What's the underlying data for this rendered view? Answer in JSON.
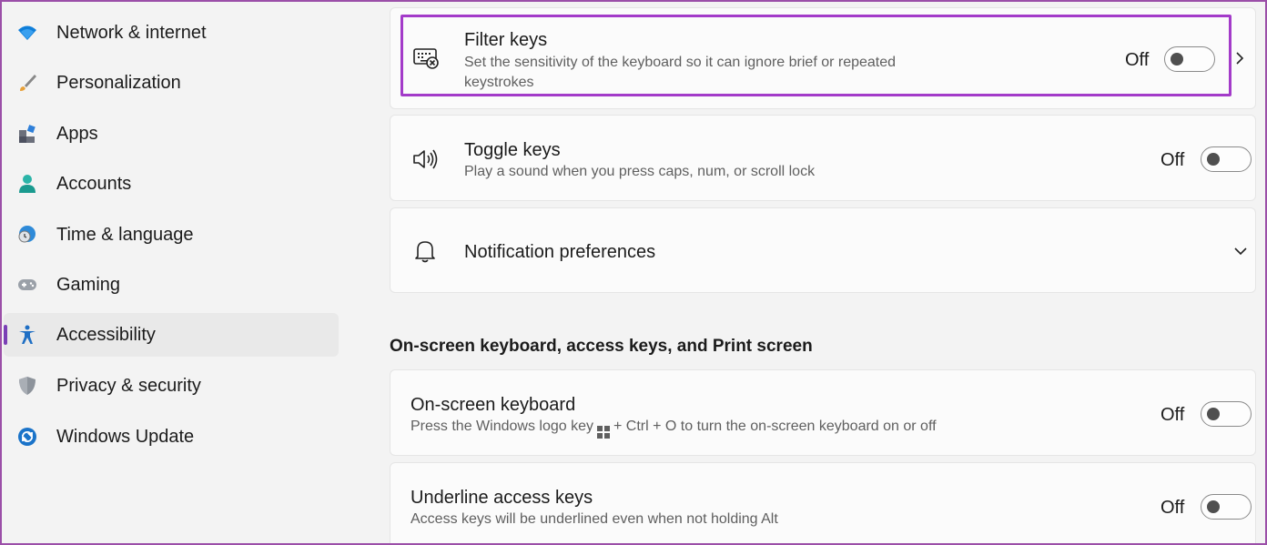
{
  "sidebar": {
    "items": [
      {
        "label": "Network & internet",
        "icon": "wifi-icon"
      },
      {
        "label": "Personalization",
        "icon": "brush-icon"
      },
      {
        "label": "Apps",
        "icon": "apps-icon"
      },
      {
        "label": "Accounts",
        "icon": "account-icon"
      },
      {
        "label": "Time & language",
        "icon": "globe-clock-icon"
      },
      {
        "label": "Gaming",
        "icon": "gamepad-icon"
      },
      {
        "label": "Accessibility",
        "icon": "accessibility-icon",
        "active": true
      },
      {
        "label": "Privacy & security",
        "icon": "shield-icon"
      },
      {
        "label": "Windows Update",
        "icon": "update-icon"
      }
    ]
  },
  "settings": {
    "filter_keys": {
      "title": "Filter keys",
      "desc_line1": "Set the sensitivity of the keyboard so it can ignore brief or repeated",
      "desc_line2": "keystrokes",
      "state": "Off"
    },
    "toggle_keys": {
      "title": "Toggle keys",
      "desc": "Play a sound when you press caps, num, or scroll lock",
      "state": "Off"
    },
    "notification_prefs": {
      "title": "Notification preferences"
    },
    "section_title": "On-screen keyboard, access keys, and Print screen",
    "onscreen_keyboard": {
      "title": "On-screen keyboard",
      "desc_before": "Press the Windows logo key",
      "desc_after": "+ Ctrl + O to turn the on-screen keyboard on or off",
      "state": "Off"
    },
    "underline_keys": {
      "title": "Underline access keys",
      "desc": "Access keys will be underlined even when not holding Alt",
      "state": "Off"
    }
  },
  "colors": {
    "accent": "#7a3fb5",
    "highlight_border": "#a33bc9"
  }
}
